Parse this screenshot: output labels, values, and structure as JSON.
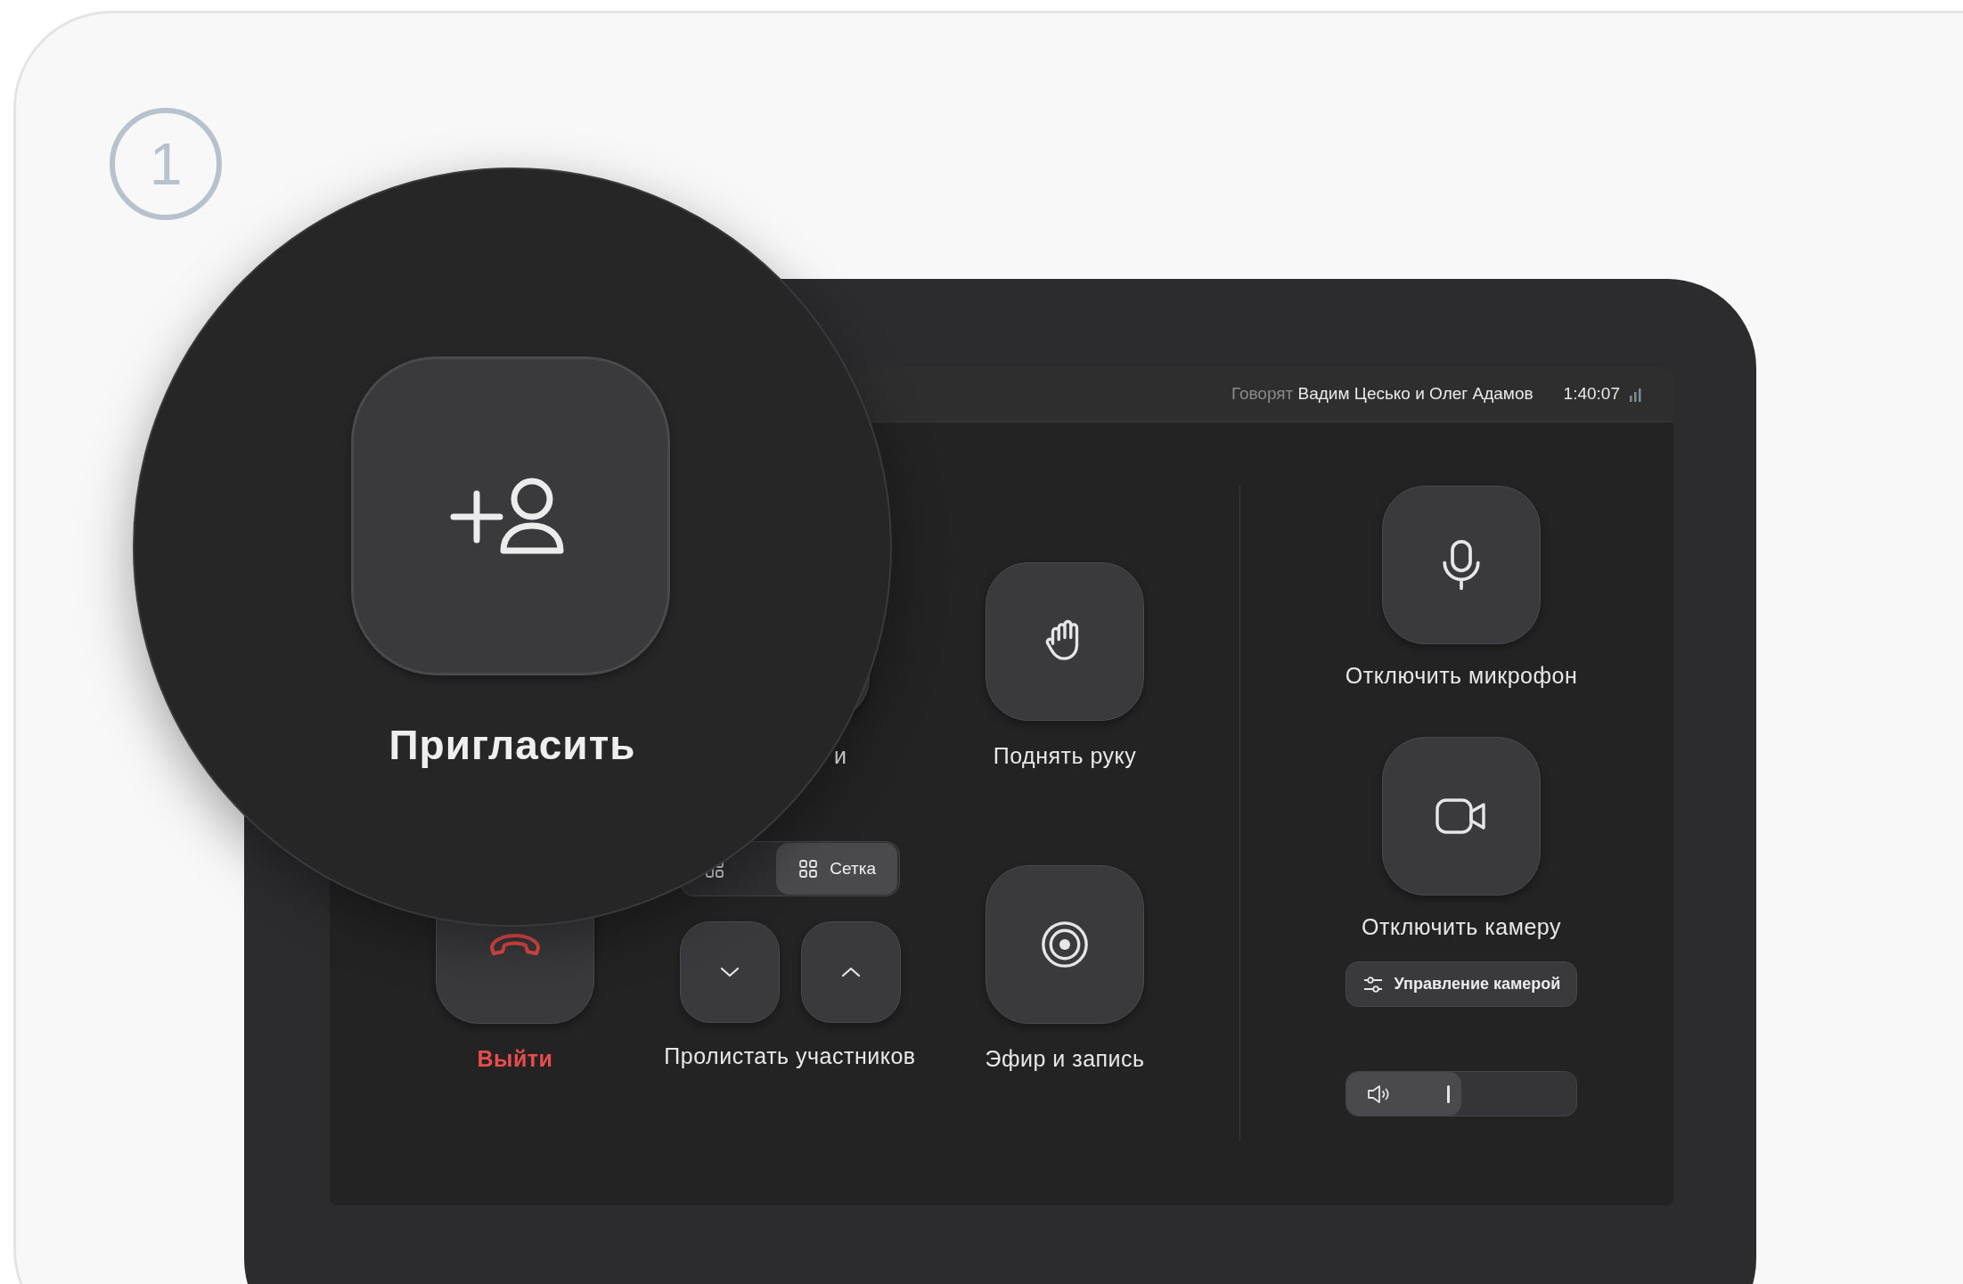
{
  "step_number": "1",
  "top_bar": {
    "speaking_prefix": "Говорят",
    "speakers": "Вадим Цесько и Олег Адамов",
    "timer": "1:40:07"
  },
  "magnifier": {
    "label": "Пригласить"
  },
  "partial_label": "и",
  "view_modes": [
    {
      "kind": "list",
      "selected": false
    },
    {
      "kind": "grid",
      "label": "Сетка",
      "selected": true
    }
  ],
  "exit": {
    "label": "Выйти"
  },
  "scroll": {
    "label": "Пролистать участников"
  },
  "raise_hand": {
    "label": "Поднять руку"
  },
  "broadcast": {
    "label": "Эфир и запись"
  },
  "microphone": {
    "label": "Отключить микрофон"
  },
  "camera": {
    "label": "Отключить камеру"
  },
  "camera_settings": {
    "label": "Управление камерой"
  },
  "volume": {
    "level": 0.5
  }
}
